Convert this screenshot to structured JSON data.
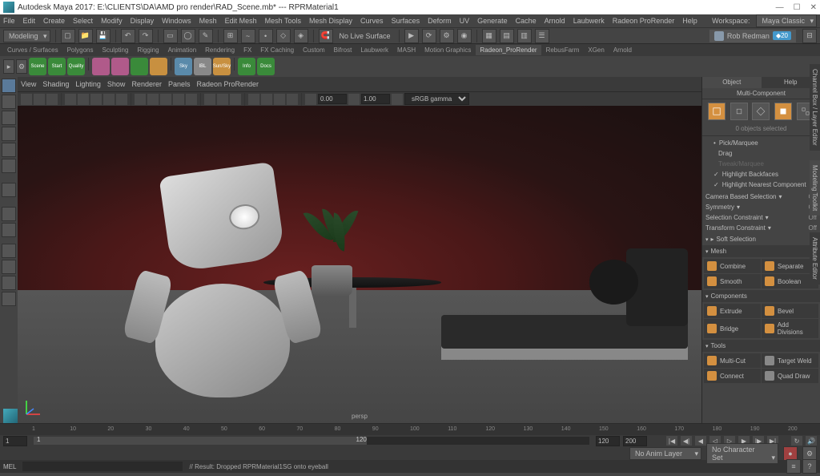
{
  "title": "Autodesk Maya 2017: E:\\CLIENTS\\DA\\AMD pro render\\RAD_Scene.mb* --- RPRMaterial1",
  "menus": [
    "File",
    "Edit",
    "Create",
    "Select",
    "Modify",
    "Display",
    "Windows",
    "Mesh",
    "Edit Mesh",
    "Mesh Tools",
    "Mesh Display",
    "Curves",
    "Surfaces",
    "Deform",
    "UV",
    "Generate",
    "Cache",
    "Arnold",
    "Laubwerk",
    "Radeon ProRender",
    "Help"
  ],
  "workspace_label": "Workspace:",
  "workspace_value": "Maya Classic",
  "mode": "Modeling",
  "toolbar_text": "No Live Surface",
  "user": "Rob Redman",
  "user_badge": "20",
  "shelf_tabs": [
    "Curves / Surfaces",
    "Polygons",
    "Sculpting",
    "Rigging",
    "Animation",
    "Rendering",
    "FX",
    "FX Caching",
    "Custom",
    "Bifrost",
    "Laubwerk",
    "MASH",
    "Motion Graphics",
    "Radeon_ProRender",
    "RebusFarm",
    "XGen",
    "Arnold"
  ],
  "shelf_active": 13,
  "shelf_btns": [
    {
      "l": "Scene",
      "c": "#3a8a3a"
    },
    {
      "l": "Start",
      "c": "#3a8a3a"
    },
    {
      "l": "Quality",
      "c": "#3a8a3a"
    },
    {
      "l": "",
      "c": "#b05a8a"
    },
    {
      "l": "",
      "c": "#b05a8a"
    },
    {
      "l": "",
      "c": "#3a8a3a"
    },
    {
      "l": "",
      "c": "#c89040"
    },
    {
      "l": "Sky",
      "c": "#5a8aaa"
    },
    {
      "l": "IBL",
      "c": "#888"
    },
    {
      "l": "Sun/Sky",
      "c": "#c89040"
    },
    {
      "l": "Info",
      "c": "#3a8a3a"
    },
    {
      "l": "Docs",
      "c": "#3a8a3a"
    }
  ],
  "view_menus": [
    "View",
    "Shading",
    "Lighting",
    "Show",
    "Renderer",
    "Panels",
    "Radeon ProRender"
  ],
  "view_val": "0.00",
  "view_scale": "1.00",
  "view_gamma": "sRGB gamma",
  "viewport_label": "persp",
  "right": {
    "tabs": [
      "Object",
      "Help"
    ],
    "multi": "Multi-Component",
    "selcount": "0 objects selected",
    "sel_opts": [
      "Pick/Marquee",
      "Drag",
      "Tweak/Marquee",
      "Highlight Backfaces",
      "Highlight Nearest Component"
    ],
    "rows": [
      {
        "l": "Camera Based Selection",
        "v": "Off"
      },
      {
        "l": "Symmetry",
        "v": "Off"
      },
      {
        "l": "Selection Constraint",
        "v": "Off"
      },
      {
        "l": "Transform Constraint",
        "v": "Off"
      }
    ],
    "soft": "Soft Selection",
    "mesh_h": "Mesh",
    "mesh": [
      {
        "l": "Combine",
        "c": "#d49040"
      },
      {
        "l": "Separate",
        "c": "#d49040"
      },
      {
        "l": "Smooth",
        "c": "#d49040"
      },
      {
        "l": "Boolean",
        "c": "#d49040"
      }
    ],
    "comp_h": "Components",
    "comp": [
      {
        "l": "Extrude",
        "c": "#d49040"
      },
      {
        "l": "Bevel",
        "c": "#d49040"
      },
      {
        "l": "Bridge",
        "c": "#d49040"
      },
      {
        "l": "Add Divisions",
        "c": "#d49040"
      }
    ],
    "tools_h": "Tools",
    "tools": [
      {
        "l": "Multi-Cut",
        "c": "#d49040"
      },
      {
        "l": "Target Weld",
        "c": "#888"
      },
      {
        "l": "Connect",
        "c": "#d49040"
      },
      {
        "l": "Quad Draw",
        "c": "#888"
      }
    ],
    "side1": "Channel Box / Layer Editor",
    "side2": "Modeling Toolkit",
    "side3": "Attribute Editor"
  },
  "time": {
    "marks": [
      "1",
      "10",
      "20",
      "30",
      "40",
      "50",
      "60",
      "70",
      "80",
      "90",
      "100",
      "110",
      "120",
      "130",
      "140",
      "150",
      "160",
      "170",
      "180",
      "190",
      "200"
    ],
    "start": "1",
    "range_start": "1",
    "range_end": "120",
    "cur": "120",
    "end": "200",
    "anim": "No Anim Layer",
    "char": "No Character Set"
  },
  "status": {
    "prefix": "MEL",
    "msg": "// Result: Dropped RPRMaterial1SG onto eyeball"
  }
}
